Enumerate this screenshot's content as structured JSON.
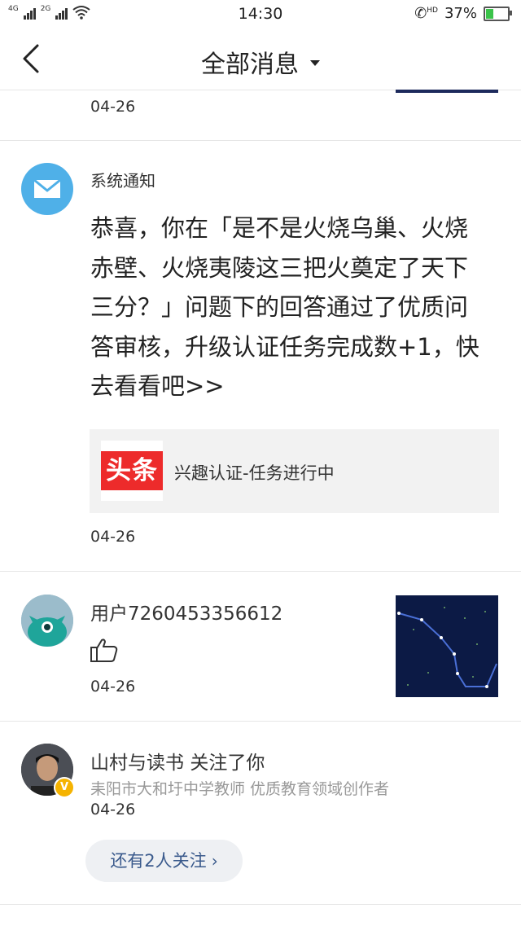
{
  "status_bar": {
    "net1": "4G",
    "net2": "2G",
    "time": "14:30",
    "hd": "HD",
    "battery": "37%",
    "battery_level": 0.37,
    "icons": [
      "signal-icon",
      "wifi-icon",
      "call-hd-icon",
      "battery-icon"
    ]
  },
  "nav": {
    "title": "全部消息",
    "back_icon": "chevron-left-icon",
    "dropdown_icon": "caret-down-icon"
  },
  "messages": [
    {
      "date": "04-26"
    },
    {
      "sender": "系统通知",
      "avatar_icon": "mail-icon",
      "text": "恭喜，你在「是不是火烧乌巢、火烧赤壁、火烧夷陵这三把火奠定了天下三分？」问题下的回答通过了优质问答审核，升级认证任务完成数+1，快去看看吧>>",
      "card": {
        "logo": "头条",
        "text": "兴趣认证-任务进行中"
      },
      "date": "04-26"
    },
    {
      "sender": "用户7260453356612",
      "action_icon": "thumbs-up-icon",
      "date": "04-26"
    },
    {
      "sender": "山村与读书",
      "action": "关注了你",
      "badge": "V",
      "description": "耒阳市大和圩中学教师 优质教育领域创作者",
      "date": "04-26",
      "more_button": "还有2人关注",
      "more_chevron": "›"
    }
  ],
  "colors": {
    "accent_blue": "#3a5a8c",
    "system_avatar": "#4fb0e8",
    "toutiao_red": "#ed2b2b",
    "battery_green": "#3bc34a"
  }
}
